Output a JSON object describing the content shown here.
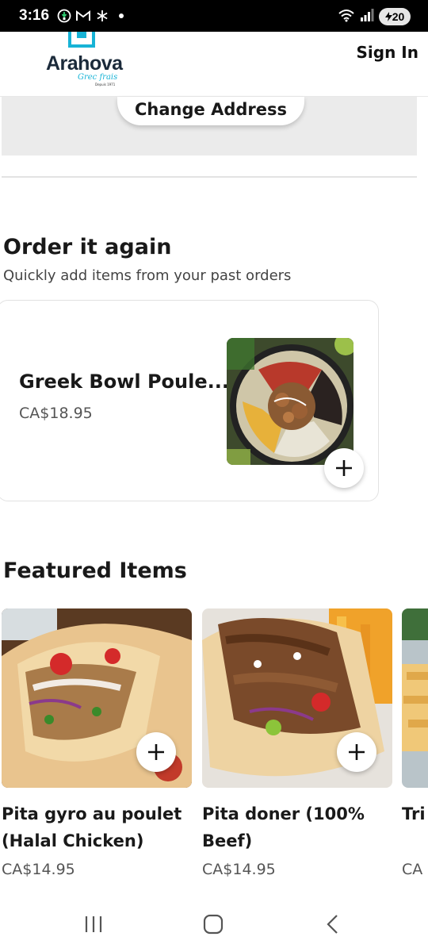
{
  "status_bar": {
    "time": "3:16",
    "battery": "20",
    "icons_left": [
      "location-icon",
      "gmail-icon",
      "snowflake-icon",
      "dot-icon"
    ],
    "icons_right": [
      "wifi-icon",
      "signal-icon"
    ]
  },
  "header": {
    "logo_name": "Arahova",
    "logo_tagline": "Grec frais",
    "logo_since": "Depuis 1971",
    "sign_in": "Sign In"
  },
  "address": {
    "change_label": "Change Address"
  },
  "order_again": {
    "title": "Order it again",
    "subtitle": "Quickly add items from your past orders",
    "items": [
      {
        "name": "Greek Bowl Poule...",
        "price": "CA$18.95"
      }
    ]
  },
  "featured": {
    "title": "Featured Items",
    "items": [
      {
        "name": "Pita gyro au poulet (Halal Chicken)",
        "price": "CA$14.95"
      },
      {
        "name": "Pita doner (100% Beef)",
        "price": "CA$14.95"
      },
      {
        "name": "Tri",
        "price": "CA"
      }
    ]
  },
  "colors": {
    "brand_accent": "#17b3d6",
    "text_primary": "#191919",
    "panel_grey": "#ebebeb"
  }
}
